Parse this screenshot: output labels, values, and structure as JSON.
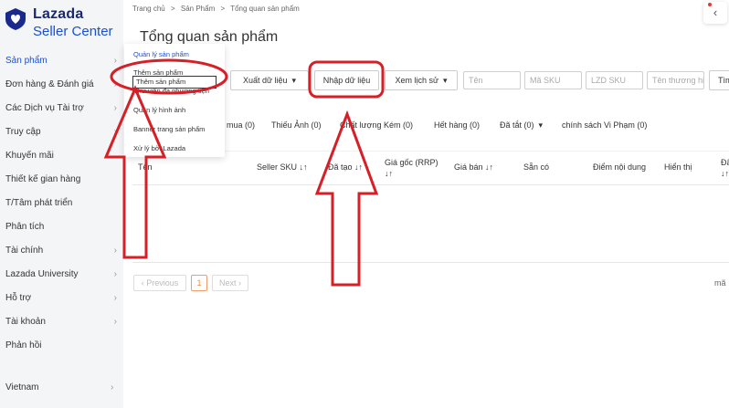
{
  "logo": {
    "brand": "Lazada",
    "product": "Seller Center"
  },
  "sidebar": {
    "items": [
      {
        "label": "Sản phẩm",
        "active": true
      },
      {
        "label": "Đơn hàng & Đánh giá"
      },
      {
        "label": "Các Dịch vụ Tài trợ"
      },
      {
        "label": "Truy cập"
      },
      {
        "label": "Khuyến mãi"
      },
      {
        "label": "Thiết kế gian hàng"
      },
      {
        "label": "T/Tâm phát triển"
      },
      {
        "label": "Phân tích"
      },
      {
        "label": "Tài chính"
      },
      {
        "label": "Lazada University"
      },
      {
        "label": "Hỗ trợ"
      },
      {
        "label": "Tài khoản"
      },
      {
        "label": "Phản hồi"
      }
    ],
    "country": "Vietnam"
  },
  "flyout": {
    "items": [
      {
        "label": "Quản lý sản phẩm",
        "active": true
      },
      {
        "label": "Thêm sản phẩm"
      },
      {
        "label": "Thư viện đa phương tiện"
      },
      {
        "label": "Quản lý hình ảnh"
      },
      {
        "label": "Banner trang sản phẩm"
      },
      {
        "label": "Xử lý bởi Lazada"
      }
    ],
    "tooltip": "Thêm sản phẩm"
  },
  "breadcrumb": {
    "home": "Trang chủ",
    "sep": ">",
    "section": "Sản Phẩm",
    "current": "Tổng quan sản phẩm"
  },
  "page": {
    "title": "Tổng quan sản phẩm"
  },
  "toolbar": {
    "export_label": "Xuất dữ liệu",
    "import_label": "Nhập dữ liệu",
    "history_label": "Xem lịch sử",
    "search_label": "Tìm",
    "placeholders": {
      "name": "Tên",
      "sku": "Mã SKU",
      "lzd_sku": "LZD SKU",
      "brand": "Tên thương hiệu"
    }
  },
  "tabs": [
    {
      "label": "mua (0)"
    },
    {
      "label": "Thiếu Ảnh (0)"
    },
    {
      "label": "Chất lượng Kém (0)"
    },
    {
      "label": "Hết hàng (0)"
    },
    {
      "label": "Đã tắt (0)"
    },
    {
      "label": "chính sách Vi Phạm (0)"
    }
  ],
  "table": {
    "columns": {
      "name": "Tên",
      "seller_sku": "Seller SKU",
      "created": "Đã tạo",
      "original_price_1": "Giá gốc (RRP)",
      "original_price_2": "↓↑",
      "sale_price": "Giá bán",
      "available": "Sẵn có",
      "content_score": "Điểm nội dung",
      "display": "Hiển thị",
      "last_1": "Đã",
      "last_2": "↓↑"
    },
    "sort_icon": "↓↑"
  },
  "pagination": {
    "previous": "‹ Previous",
    "page": "1",
    "next": "Next ›",
    "right_text": "mã"
  },
  "icons": {
    "logo": "lazada-heart-logo",
    "chevron": "›",
    "dropdown": "▾",
    "corner": "‹"
  },
  "colors": {
    "accent": "#1a4fd6",
    "annotation": "#d61f26"
  }
}
